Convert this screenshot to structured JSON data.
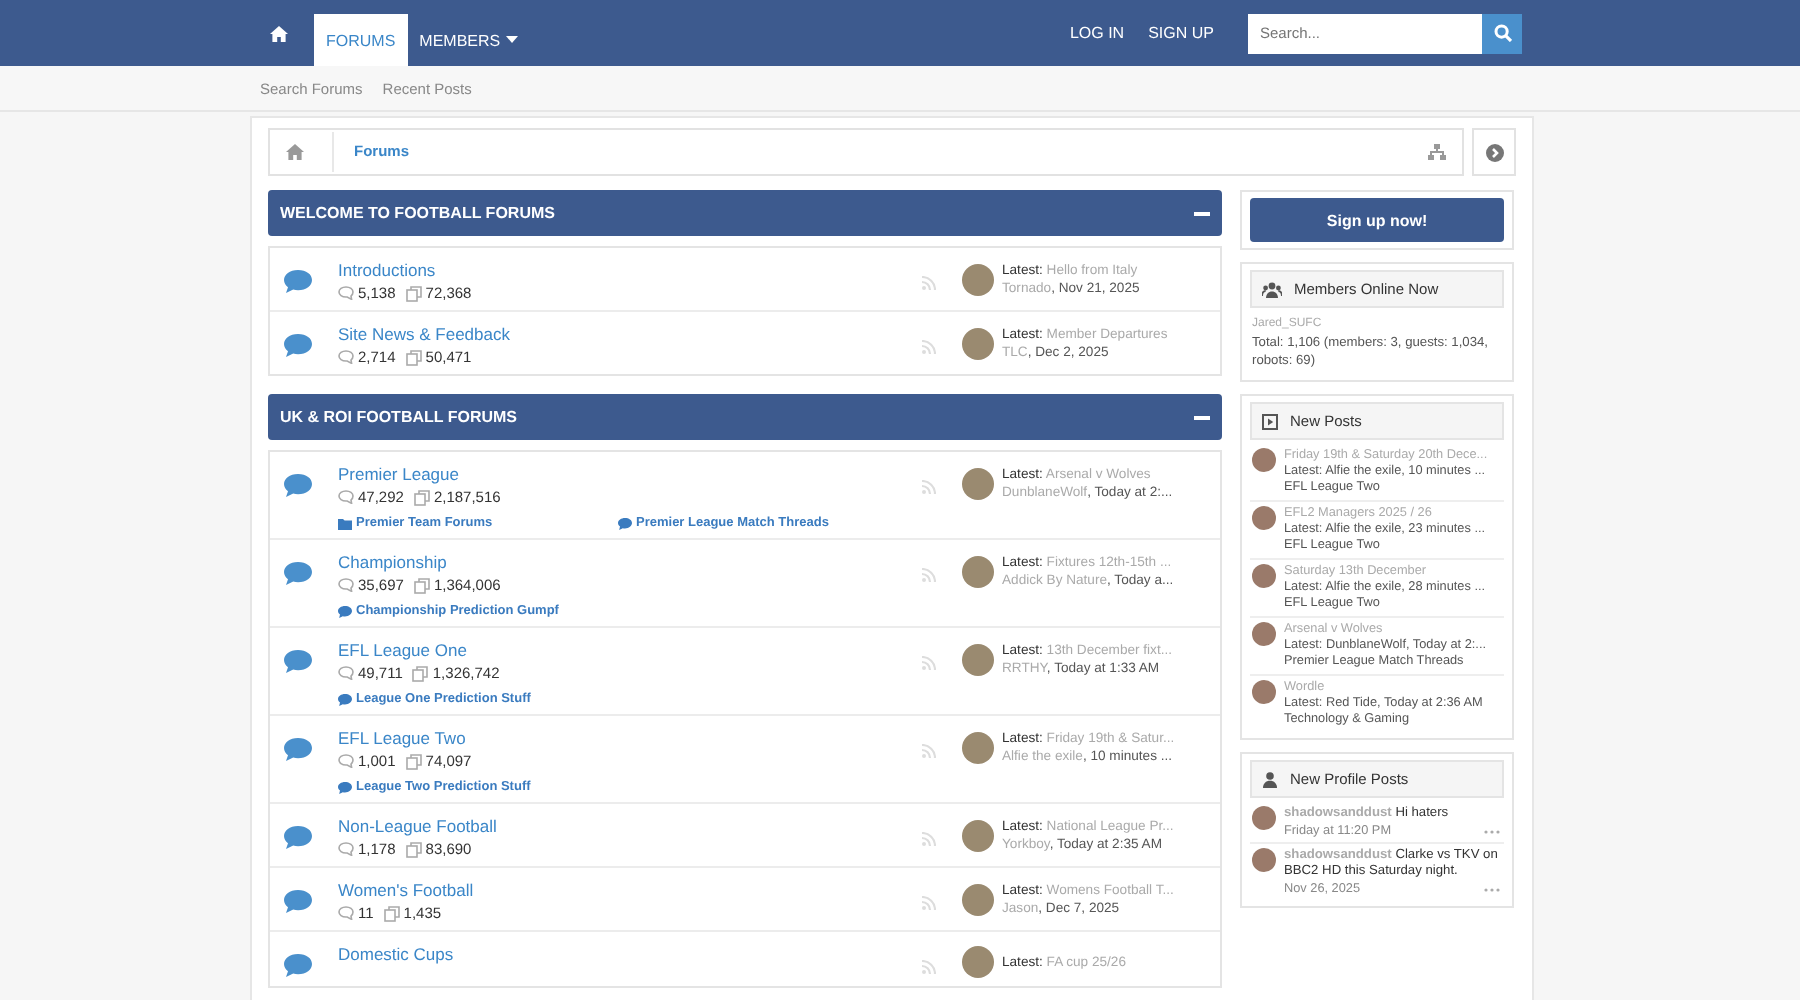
{
  "nav": {
    "tabs": [
      {
        "label": "FORUMS",
        "selected": true,
        "dropdown": false
      },
      {
        "label": "MEMBERS",
        "selected": false,
        "dropdown": true
      }
    ],
    "links": [
      "LOG IN",
      "SIGN UP"
    ],
    "search": {
      "placeholder": "Search..."
    }
  },
  "subnav": [
    "Search Forums",
    "Recent Posts"
  ],
  "breadcrumb": [
    "Forums"
  ],
  "categories": [
    {
      "title": "WELCOME TO FOOTBALL FORUMS",
      "expanded": true,
      "forums": [
        {
          "title": "Introductions",
          "messages": "5,138",
          "threads": "72,368",
          "latest": {
            "label": "Latest:",
            "title": "Hello from Italy",
            "user": "Tornado",
            "date": ", Nov 21, 2025"
          }
        },
        {
          "title": "Site News & Feedback",
          "messages": "2,714",
          "threads": "50,471",
          "latest": {
            "label": "Latest:",
            "title": "Member Departures",
            "user": "TLC",
            "date": ", Dec 2, 2025"
          }
        }
      ]
    },
    {
      "title": "UK & ROI FOOTBALL FORUMS",
      "expanded": true,
      "forums": [
        {
          "title": "Premier League",
          "messages": "47,292",
          "threads": "2,187,516",
          "subforums": [
            {
              "kind": "folder",
              "label": "Premier Team Forums"
            },
            {
              "kind": "forum",
              "label": "Premier League Match Threads"
            }
          ],
          "latest": {
            "label": "Latest:",
            "title": "Arsenal v Wolves",
            "user": "DunblaneWolf",
            "date": ", Today at 2:..."
          }
        },
        {
          "title": "Championship",
          "messages": "35,697",
          "threads": "1,364,006",
          "subforums": [
            {
              "kind": "forum",
              "label": "Championship Prediction Gumpf"
            }
          ],
          "latest": {
            "label": "Latest:",
            "title": "Fixtures 12th-15th ...",
            "user": "Addick By Nature",
            "date": ", Today a..."
          }
        },
        {
          "title": "EFL League One",
          "messages": "49,711",
          "threads": "1,326,742",
          "subforums": [
            {
              "kind": "forum",
              "label": "League One Prediction Stuff"
            }
          ],
          "latest": {
            "label": "Latest:",
            "title": "13th December fixt...",
            "user": "RRTHY",
            "date": ", Today at 1:33 AM"
          }
        },
        {
          "title": "EFL League Two",
          "messages": "1,001",
          "threads": "74,097",
          "subforums": [
            {
              "kind": "forum",
              "label": "League Two Prediction Stuff"
            }
          ],
          "latest": {
            "label": "Latest:",
            "title": "Friday 19th & Satur...",
            "user": "Alfie the exile",
            "date": ", 10 minutes ..."
          }
        },
        {
          "title": "Non-League Football",
          "messages": "1,178",
          "threads": "83,690",
          "latest": {
            "label": "Latest:",
            "title": "National League Pr...",
            "user": "Yorkboy",
            "date": ", Today at 2:35 AM"
          }
        },
        {
          "title": "Women's Football",
          "messages": "11",
          "threads": "1,435",
          "latest": {
            "label": "Latest:",
            "title": "Womens Football T...",
            "user": "Jason",
            "date": ", Dec 7, 2025"
          }
        },
        {
          "title": "Domestic Cups",
          "latest": {
            "label": "Latest:",
            "title": "FA cup 25/26"
          }
        }
      ]
    }
  ],
  "sidebar": {
    "signup": "Sign up now!",
    "online": {
      "title": "Members Online Now",
      "members": [
        "Jared_SUFC"
      ],
      "total": "Total: 1,106 (members: 3, guests: 1,034, robots: 69)"
    },
    "new_posts": {
      "title": "New Posts",
      "items": [
        {
          "title": "Friday 19th & Saturday 20th Dece...",
          "latest": "Latest: Alfie the exile, 10 minutes ...",
          "forum": "EFL League Two"
        },
        {
          "title": "EFL2 Managers 2025 / 26",
          "latest": "Latest: Alfie the exile, 23 minutes ...",
          "forum": "EFL League Two"
        },
        {
          "title": "Saturday 13th December",
          "latest": "Latest: Alfie the exile, 28 minutes ...",
          "forum": "EFL League Two"
        },
        {
          "title": "Arsenal v Wolves",
          "latest": "Latest: DunblaneWolf, Today at 2:...",
          "forum": "Premier League Match Threads"
        },
        {
          "title": "Wordle",
          "latest": "Latest: Red Tide, Today at 2:36 AM",
          "forum": "Technology & Gaming"
        }
      ]
    },
    "profile_posts": {
      "title": "New Profile Posts",
      "items": [
        {
          "user": "shadowsanddust",
          "text": "Hi haters",
          "date": "Friday at 11:20 PM"
        },
        {
          "user": "shadowsanddust",
          "text": "Clarke vs TKV on BBC2 HD this Saturday night.",
          "date": "Nov 26, 2025"
        }
      ]
    }
  }
}
